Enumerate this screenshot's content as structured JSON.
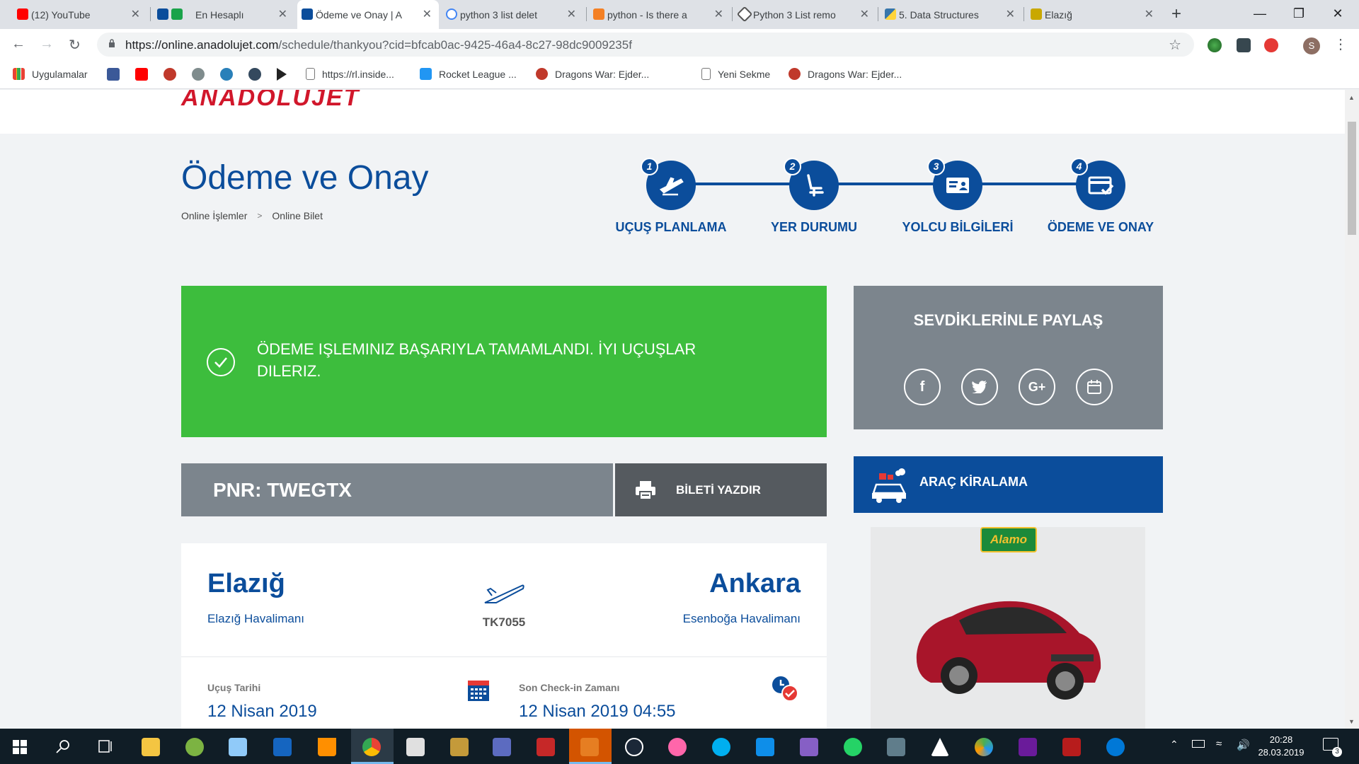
{
  "browser": {
    "tabs": [
      {
        "label": "(12) YouTube",
        "color": "#ff0000"
      },
      {
        "label": "En Hesaplı",
        "color": "#0b4d9b"
      },
      {
        "label": "Ödeme ve Onay | A",
        "color": "#0b4d9b"
      },
      {
        "label": "python 3 list delet",
        "color": "#4285f4"
      },
      {
        "label": "python - Is there a",
        "color": "#f48024"
      },
      {
        "label": "Python 3 List remo",
        "color": "#555555"
      },
      {
        "label": "5. Data Structures",
        "color": "#3776ab"
      },
      {
        "label": "Elazığ",
        "color": "#c9a800"
      }
    ],
    "active_tab": 2,
    "close_glyph": "✕",
    "new_tab_glyph": "+",
    "url_host": "https://online.anadolujet.com",
    "url_path": "/schedule/thankyou?cid=bfcab0ac-9425-46a4-8c27-98dc9009235f",
    "profile_initial": "S",
    "bookmarks": [
      {
        "label": "Uygulamalar",
        "color": "#e94235"
      },
      {
        "label": "https://rl.inside...",
        "color": "#ffffff"
      },
      {
        "label": "Rocket League ...",
        "color": "#2196f3"
      },
      {
        "label": "Dragons War: Ejder...",
        "color": "#c0392b"
      },
      {
        "label": "Yeni Sekme",
        "color": "#ffffff"
      },
      {
        "label": "Dragons War: Ejder...",
        "color": "#c0392b"
      }
    ]
  },
  "site": {
    "logo": "ANADOLUJET",
    "page_title": "Ödeme ve Onay",
    "breadcrumb": [
      "Online İşlemler",
      "Online Bilet"
    ],
    "breadcrumb_sep": ">",
    "steps": [
      {
        "num": "1",
        "label": "UÇUŞ PLANLAMA",
        "icon": "plane-takeoff-icon"
      },
      {
        "num": "2",
        "label": "YER DURUMU",
        "icon": "seat-icon"
      },
      {
        "num": "3",
        "label": "YOLCU BİLGİLERİ",
        "icon": "id-card-icon"
      },
      {
        "num": "4",
        "label": "ÖDEME VE ONAY",
        "icon": "credit-card-check-icon"
      }
    ],
    "success_message": "Ödeme işleminiz başarıyla tamamlandı. İyi uçuşlar dileriz.",
    "pnr": "PNR: TWEGTX",
    "print_label": "BİLETİ YAZDIR",
    "flight": {
      "from_city": "Elazığ",
      "from_airport": "Elazığ Havalimanı",
      "to_city": "Ankara",
      "to_airport": "Esenboğa Havalimanı",
      "flight_number": "TK7055",
      "date_label": "Uçuş Tarihi",
      "date_value": "12 Nisan 2019",
      "checkin_label": "Son Check-in Zamanı",
      "checkin_value": "12 Nisan 2019 04:55"
    },
    "share": {
      "title": "SEVDİKLERİNLE PAYLAŞ",
      "buttons": [
        {
          "glyph": "f",
          "icon": "facebook-icon"
        },
        {
          "glyph": "🐦",
          "icon": "twitter-icon"
        },
        {
          "glyph": "G+",
          "icon": "google-plus-icon"
        },
        {
          "glyph": "▦",
          "icon": "calendar-icon"
        }
      ]
    },
    "rental": {
      "title": "ARAÇ KİRALAMA",
      "brand": "Alamo"
    },
    "colors": {
      "primary": "#0b4d9b",
      "success": "#3dbd3d",
      "gray_panel": "#7c858d",
      "logo_red": "#d1172b"
    }
  },
  "taskbar": {
    "time": "20:28",
    "date": "28.03.2019",
    "notification_count": "3"
  }
}
